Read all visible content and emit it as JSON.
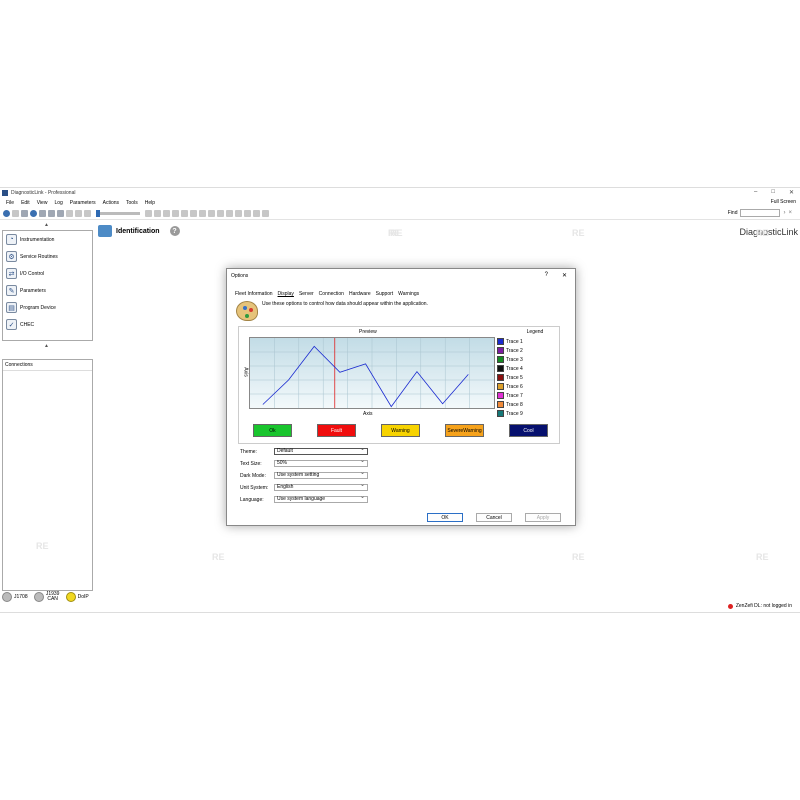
{
  "app": {
    "title": "DiagnosticLink - Professional",
    "brand": "DiagnosticLink",
    "full_screen": "Full Screen",
    "find_label": "Find",
    "watermark": "RE"
  },
  "menu": [
    "File",
    "Edit",
    "View",
    "Log",
    "Parameters",
    "Actions",
    "Tools",
    "Help"
  ],
  "window_buttons": {
    "minimize": "–",
    "restore": "□",
    "close": "✕"
  },
  "nav": {
    "items": [
      {
        "label": "Instrumentation",
        "icon": "gauge-icon"
      },
      {
        "label": "Service Routines",
        "icon": "wrench-icon"
      },
      {
        "label": "I/O Control",
        "icon": "io-icon"
      },
      {
        "label": "Parameters",
        "icon": "parameters-icon"
      },
      {
        "label": "Program Device",
        "icon": "chip-icon"
      },
      {
        "label": "CHEC",
        "icon": "check-icon"
      }
    ]
  },
  "connections": {
    "header": "Connections"
  },
  "status": [
    {
      "label": "J1708"
    },
    {
      "label": "J1939 CAN"
    },
    {
      "label": "DoIP"
    }
  ],
  "main": {
    "title": "Identification"
  },
  "footer": {
    "login": "ZenZefi DL: not logged in"
  },
  "dialog": {
    "title": "Options",
    "help": "?",
    "close": "✕",
    "tabs": [
      "Fleet Information",
      "Display",
      "Server",
      "Connection",
      "Hardware",
      "Support",
      "Warnings"
    ],
    "intro": "Use these options to control how data should appear within the application.",
    "preview_label": "Preview",
    "legend_label": "Legend",
    "axis_label": "Axis",
    "y_label": "Axis",
    "status_buttons": [
      {
        "label": "Ok",
        "color": "#19c52d"
      },
      {
        "label": "Fault",
        "color": "#f00d0d"
      },
      {
        "label": "Warning",
        "color": "#f7d300"
      },
      {
        "label": "SevereWarning",
        "color": "#f6a21b"
      },
      {
        "label": "Cool",
        "color": "#06106e"
      }
    ],
    "form": [
      {
        "label": "Theme:",
        "value": "Default"
      },
      {
        "label": "Text Size:",
        "value": "50%"
      },
      {
        "label": "Dark Mode:",
        "value": "Use system setting"
      },
      {
        "label": "Unit System:",
        "value": "English"
      },
      {
        "label": "Language:",
        "value": "Use system language"
      }
    ],
    "buttons": {
      "ok": "OK",
      "cancel": "Cancel",
      "apply": "Apply"
    }
  },
  "chart_data": {
    "type": "line",
    "title": "Preview",
    "xlabel": "Axis",
    "ylabel": "Axis",
    "x": [
      0,
      1,
      2,
      3,
      4,
      5,
      6,
      7,
      8
    ],
    "xlim": [
      0,
      9.5
    ],
    "ylim": [
      0,
      10
    ],
    "marker_x": 3.3,
    "series": [
      {
        "name": "Trace 1",
        "values": [
          0.5,
          4,
          8.8,
          5.1,
          6.3,
          0.2,
          5.2,
          0.6,
          4.8
        ],
        "color": "#1a2ad0"
      }
    ],
    "legend": [
      {
        "name": "Trace 1",
        "color": "#1a2ad0"
      },
      {
        "name": "Trace 2",
        "color": "#7d1ca3"
      },
      {
        "name": "Trace 3",
        "color": "#158a22"
      },
      {
        "name": "Trace 4",
        "color": "#111111"
      },
      {
        "name": "Trace 5",
        "color": "#8a1010"
      },
      {
        "name": "Trace 6",
        "color": "#dca02c"
      },
      {
        "name": "Trace 7",
        "color": "#e030d4"
      },
      {
        "name": "Trace 8",
        "color": "#f08a3a"
      },
      {
        "name": "Trace 9",
        "color": "#147878"
      }
    ],
    "grid": true,
    "legend_position": "right"
  }
}
